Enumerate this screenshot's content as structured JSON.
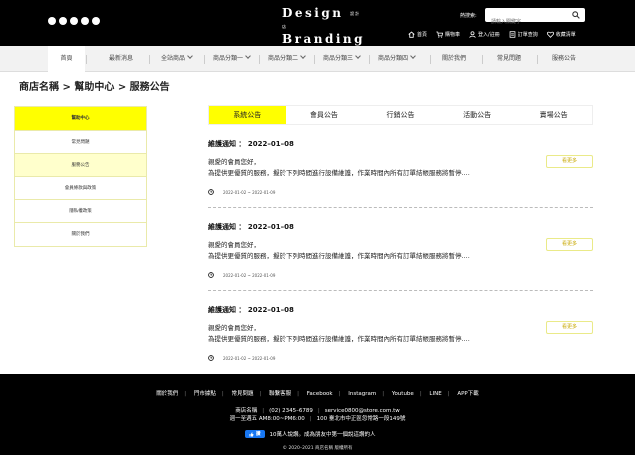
{
  "header": {
    "social_icons": [
      "facebook-icon",
      "instagram-icon",
      "youtube-icon",
      "line-icon",
      "messenger-icon"
    ],
    "logo": {
      "line1": "Design",
      "line1_small": "設計店",
      "line2": "Branding",
      "line3": "COMPANY"
    },
    "hot_label": "熱搜索:",
    "search": {
      "placeholder": "請輸入關鍵字"
    },
    "links": [
      {
        "icon": "home-icon",
        "label": "首頁"
      },
      {
        "icon": "cart-icon",
        "label": "購物車"
      },
      {
        "icon": "user-icon",
        "label": "登入/註冊"
      },
      {
        "icon": "order-icon",
        "label": "訂單查詢"
      },
      {
        "icon": "heart-icon",
        "label": "收藏清單"
      }
    ]
  },
  "nav": {
    "items": [
      {
        "label": "首頁",
        "dropdown": false
      },
      {
        "label": "最新消息",
        "dropdown": false
      },
      {
        "label": "全站商品",
        "dropdown": true
      },
      {
        "label": "商品分類一",
        "dropdown": true
      },
      {
        "label": "商品分類二",
        "dropdown": true
      },
      {
        "label": "商品分類三",
        "dropdown": true
      },
      {
        "label": "商品分類四",
        "dropdown": true
      },
      {
        "label": "關於我們",
        "dropdown": false
      },
      {
        "label": "常見問題",
        "dropdown": false
      },
      {
        "label": "服務公告",
        "dropdown": false
      }
    ]
  },
  "breadcrumb": "商店名稱 > 幫助中心 > 服務公告",
  "sidebar": {
    "items": [
      {
        "label": "幫助中心"
      },
      {
        "label": "常見問題"
      },
      {
        "label": "服務公告"
      },
      {
        "label": "會員條款與政策"
      },
      {
        "label": "隱私權政策"
      },
      {
        "label": "關於我們"
      }
    ]
  },
  "tabs": [
    "系統公告",
    "會員公告",
    "行銷公告",
    "活動公告",
    "賣場公告"
  ],
  "announcements": [
    {
      "title": "維護通知 ： 2022–01–08",
      "line1": "親愛的會員您好，",
      "line2": "為提供更優質的服務，擬於下列時間進行設備維護，作業時間內所有訂單結帳服務將暫停....",
      "time": "2022-01-02 ~ 2022-01-09",
      "more": "看更多"
    },
    {
      "title": "維護通知 ： 2022–01–08",
      "line1": "親愛的會員您好，",
      "line2": "為提供更優質的服務，擬於下列時間進行設備維護，作業時間內所有訂單結帳服務將暫停....",
      "time": "2022-01-02 ~ 2022-01-09",
      "more": "看更多"
    },
    {
      "title": "維護通知 ： 2022–01–08",
      "line1": "親愛的會員您好，",
      "line2": "為提供更優質的服務，擬於下列時間進行設備維護，作業時間內所有訂單結帳服務將暫停....",
      "time": "2022-01-02 ~ 2022-01-09",
      "more": "看更多"
    }
  ],
  "footer": {
    "links": [
      "關於我們",
      "門市據點",
      "常見問題",
      "聯繫客服",
      "Facebook",
      "Instagram",
      "Youtube",
      "LINE",
      "APP下載"
    ],
    "store_name": "商店名稱",
    "phone": "(02) 2345–6789",
    "email": "service0800@store.com.tw",
    "hours": "週一至週五 AM8:00~PM6:00",
    "address": "100 臺北市中正區忽常路一段149號",
    "fb_button": "讚",
    "fb_text": "10萬人說讚。成為朋友中第一個說這讚的人",
    "copyright": "© 2020–2021 商店名稱 版權所有"
  },
  "colors": {
    "accent": "#ffff00",
    "accent_light": "#ffffcc",
    "header_bg": "#000000",
    "more_text": "#c8a800"
  }
}
